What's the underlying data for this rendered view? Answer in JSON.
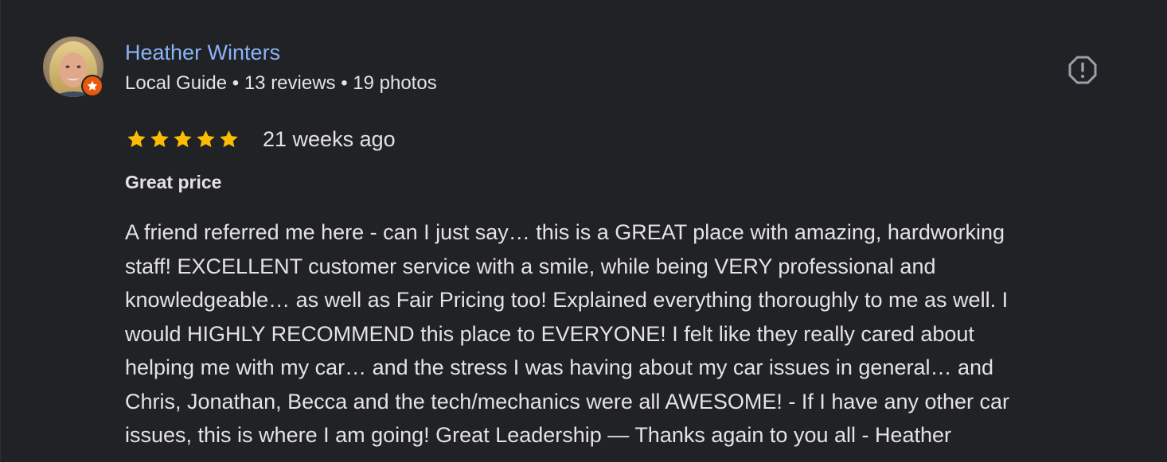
{
  "reviewer": {
    "name": "Heather Winters",
    "meta": "Local Guide • 13 reviews • 19 photos",
    "badge_icon": "star-badge-icon",
    "badge_color": "#e8590c"
  },
  "review": {
    "rating": 5,
    "rating_max": 5,
    "star_color": "#fbbc04",
    "time": "21 weeks ago",
    "title": "Great price",
    "lines": [
      "A friend referred me here - can I just say… this is a GREAT place with amazing, hardworking",
      "staff! EXCELLENT customer service with a smile, while being VERY professional and",
      "knowledgeable… as well as Fair Pricing too! Explained everything thoroughly to me as well. I",
      "would HIGHLY RECOMMEND this place to EVERYONE! I felt like they really cared about",
      "helping me with my car… and the stress I was having about my car issues in general… and",
      "Chris, Jonathan, Becca and the tech/mechanics were all AWESOME! - If I have any other car",
      "issues, this is where I am going! Great Leadership — Thanks again to you all - Heather"
    ]
  },
  "actions": {
    "report_icon": "report-icon"
  },
  "colors": {
    "background": "#212225",
    "name_link": "#8ab4f8",
    "text": "#e3e3e3",
    "icon": "#9aa0a6"
  }
}
